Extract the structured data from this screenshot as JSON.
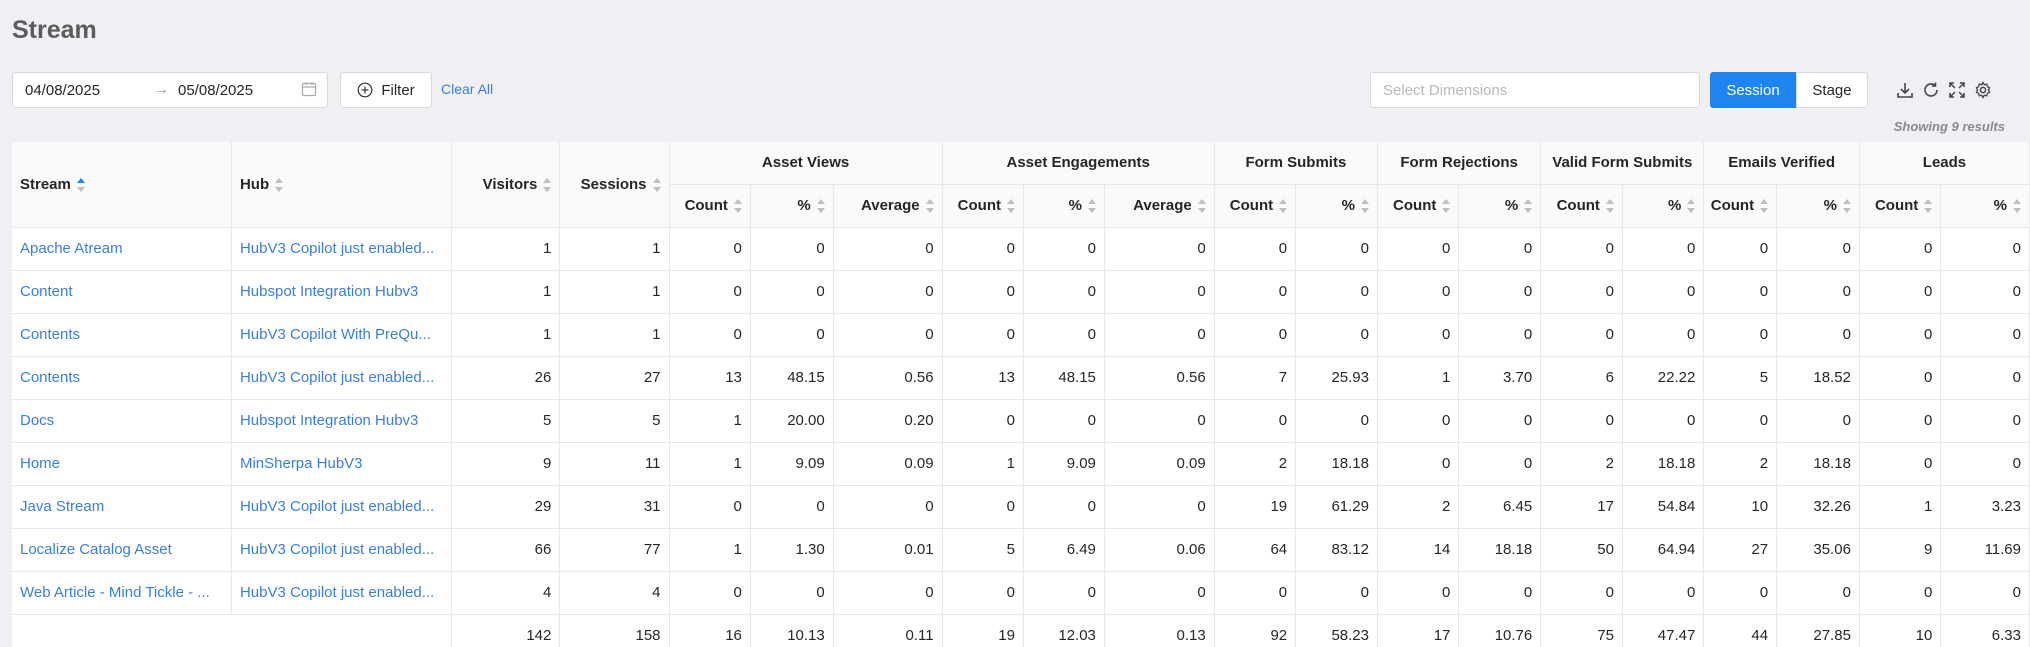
{
  "page": {
    "title": "Stream"
  },
  "toolbar": {
    "date_start": "04/08/2025",
    "date_end": "05/08/2025",
    "date_arrow": "→",
    "filter_label": "Filter",
    "clear_all_label": "Clear All",
    "dimensions_placeholder": "Select Dimensions",
    "session_label": "Session",
    "stage_label": "Stage",
    "results_label": "Showing 9 results",
    "icons": [
      "download-icon",
      "refresh-icon",
      "fullscreen-icon",
      "settings-icon"
    ]
  },
  "colors": {
    "accent": "#1d84f0",
    "link": "#3a7fd5",
    "background": "#eef0f4"
  },
  "table": {
    "columns": {
      "stream": "Stream",
      "hub": "Hub",
      "visitors": "Visitors",
      "sessions": "Sessions"
    },
    "groups": [
      {
        "label": "Asset Views",
        "sub": [
          "Count",
          "%",
          "Average"
        ]
      },
      {
        "label": "Asset Engagements",
        "sub": [
          "Count",
          "%",
          "Average"
        ]
      },
      {
        "label": "Form Submits",
        "sub": [
          "Count",
          "%"
        ]
      },
      {
        "label": "Form Rejections",
        "sub": [
          "Count",
          "%"
        ]
      },
      {
        "label": "Valid Form Submits",
        "sub": [
          "Count",
          "%"
        ]
      },
      {
        "label": "Emails Verified",
        "sub": [
          "Count",
          "%"
        ]
      },
      {
        "label": "Leads",
        "sub": [
          "Count",
          "%"
        ]
      }
    ],
    "rows": [
      {
        "stream": "Apache Atream",
        "hub": "HubV3 Copilot just enabled...",
        "values": [
          "1",
          "1",
          "0",
          "0",
          "0",
          "0",
          "0",
          "0",
          "0",
          "0",
          "0",
          "0",
          "0",
          "0",
          "0",
          "0",
          "0",
          "0"
        ]
      },
      {
        "stream": "Content",
        "hub": "Hubspot Integration Hubv3",
        "values": [
          "1",
          "1",
          "0",
          "0",
          "0",
          "0",
          "0",
          "0",
          "0",
          "0",
          "0",
          "0",
          "0",
          "0",
          "0",
          "0",
          "0",
          "0"
        ]
      },
      {
        "stream": "Contents",
        "hub": "HubV3 Copilot With PreQu...",
        "values": [
          "1",
          "1",
          "0",
          "0",
          "0",
          "0",
          "0",
          "0",
          "0",
          "0",
          "0",
          "0",
          "0",
          "0",
          "0",
          "0",
          "0",
          "0"
        ]
      },
      {
        "stream": "Contents",
        "hub": "HubV3 Copilot just enabled...",
        "values": [
          "26",
          "27",
          "13",
          "48.15",
          "0.56",
          "13",
          "48.15",
          "0.56",
          "7",
          "25.93",
          "1",
          "3.70",
          "6",
          "22.22",
          "5",
          "18.52",
          "0",
          "0"
        ]
      },
      {
        "stream": "Docs",
        "hub": "Hubspot Integration Hubv3",
        "values": [
          "5",
          "5",
          "1",
          "20.00",
          "0.20",
          "0",
          "0",
          "0",
          "0",
          "0",
          "0",
          "0",
          "0",
          "0",
          "0",
          "0",
          "0",
          "0"
        ]
      },
      {
        "stream": "Home",
        "hub": "MinSherpa HubV3",
        "values": [
          "9",
          "11",
          "1",
          "9.09",
          "0.09",
          "1",
          "9.09",
          "0.09",
          "2",
          "18.18",
          "0",
          "0",
          "2",
          "18.18",
          "2",
          "18.18",
          "0",
          "0"
        ]
      },
      {
        "stream": "Java Stream",
        "hub": "HubV3 Copilot just enabled...",
        "values": [
          "29",
          "31",
          "0",
          "0",
          "0",
          "0",
          "0",
          "0",
          "19",
          "61.29",
          "2",
          "6.45",
          "17",
          "54.84",
          "10",
          "32.26",
          "1",
          "3.23"
        ]
      },
      {
        "stream": "Localize Catalog Asset",
        "hub": "HubV3 Copilot just enabled...",
        "values": [
          "66",
          "77",
          "1",
          "1.30",
          "0.01",
          "5",
          "6.49",
          "0.06",
          "64",
          "83.12",
          "14",
          "18.18",
          "50",
          "64.94",
          "27",
          "35.06",
          "9",
          "11.69"
        ]
      },
      {
        "stream": "Web Article - Mind Tickle - ...",
        "hub": "HubV3 Copilot just enabled...",
        "values": [
          "4",
          "4",
          "0",
          "0",
          "0",
          "0",
          "0",
          "0",
          "0",
          "0",
          "0",
          "0",
          "0",
          "0",
          "0",
          "0",
          "0",
          "0"
        ]
      }
    ],
    "totals": [
      "142",
      "158",
      "16",
      "10.13",
      "0.11",
      "19",
      "12.03",
      "0.13",
      "92",
      "58.23",
      "17",
      "10.76",
      "75",
      "47.47",
      "44",
      "27.85",
      "10",
      "6.33"
    ]
  }
}
